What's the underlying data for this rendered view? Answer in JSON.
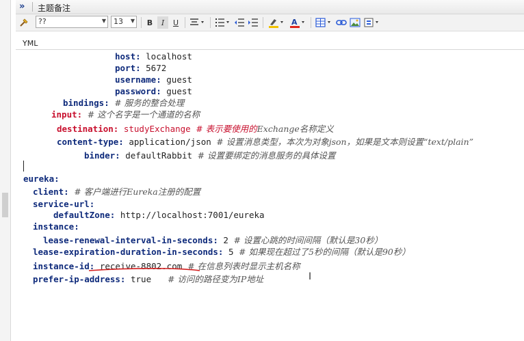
{
  "window": {
    "title": "主题备注",
    "expand_glyph": "»"
  },
  "toolbar": {
    "font_name": "??",
    "font_size": "13",
    "bold": "B",
    "italic": "I",
    "underline": "U",
    "highlight_color": "#f2c200",
    "font_color": "#e0251b"
  },
  "editor": {
    "mode_label": "YML",
    "lines": [
      [
        [
          "host: ",
          "k"
        ],
        [
          "localhost",
          "v"
        ]
      ],
      [
        [
          "port: ",
          "k"
        ],
        [
          "5672",
          "v"
        ]
      ],
      [
        [
          "username: ",
          "k"
        ],
        [
          "guest",
          "v"
        ]
      ],
      [
        [
          "password: ",
          "k"
        ],
        [
          "guest",
          "v"
        ]
      ],
      [
        [
          "bindings: ",
          "k"
        ],
        [
          "# 服务的整合处理",
          "c"
        ]
      ],
      [
        [
          "input: ",
          "k2"
        ],
        [
          "# 这个名字是一个通道的名称",
          "c"
        ]
      ],
      [
        [
          "destination: ",
          "k2"
        ],
        [
          "studyExchange ",
          "v2"
        ],
        [
          "# 表示要使用的",
          "c2"
        ],
        [
          "Exchange名称定义",
          "c"
        ]
      ],
      [
        [
          "content-type: ",
          "k"
        ],
        [
          "application/json ",
          "v"
        ],
        [
          "# 设置消息类型，本次为对象json，如果是文本则设置“text/plain”",
          "c"
        ]
      ],
      [
        [
          "binder: ",
          "k"
        ],
        [
          "defaultRabbit ",
          "v"
        ],
        [
          "# 设置要绑定的消息服务的具体设置",
          "c"
        ]
      ],
      [],
      [
        [
          "eureka:",
          "k"
        ]
      ],
      [
        [
          "client: ",
          "k"
        ],
        [
          "# 客户端进行Eureka注册的配置",
          "c"
        ]
      ],
      [
        [
          "service-url:",
          "k"
        ]
      ],
      [
        [
          "defaultZone: ",
          "k"
        ],
        [
          "http://localhost:7001/eureka",
          "v"
        ]
      ],
      [
        [
          "instance:",
          "k"
        ]
      ],
      [
        [
          "lease-renewal-interval-in-seconds: ",
          "k"
        ],
        [
          "2 ",
          "v"
        ],
        [
          "# 设置心跳的时间间隔（默认是30秒）",
          "c"
        ]
      ],
      [
        [
          "lease-expiration-duration-in-seconds: ",
          "k"
        ],
        [
          "5 ",
          "v"
        ],
        [
          "# 如果现在超过了5秒的间隔（默认是90秒）",
          "c"
        ]
      ],
      [
        [
          "instance-id: ",
          "k"
        ],
        [
          "receive-8802.com",
          "v"
        ],
        [
          "  # 在信息列表时显示主机名称",
          "c"
        ]
      ],
      [
        [
          "prefer-ip-address: ",
          "k"
        ],
        [
          "true",
          "v"
        ],
        [
          "      # 访问的路径变为IP地址",
          "c"
        ]
      ]
    ]
  }
}
